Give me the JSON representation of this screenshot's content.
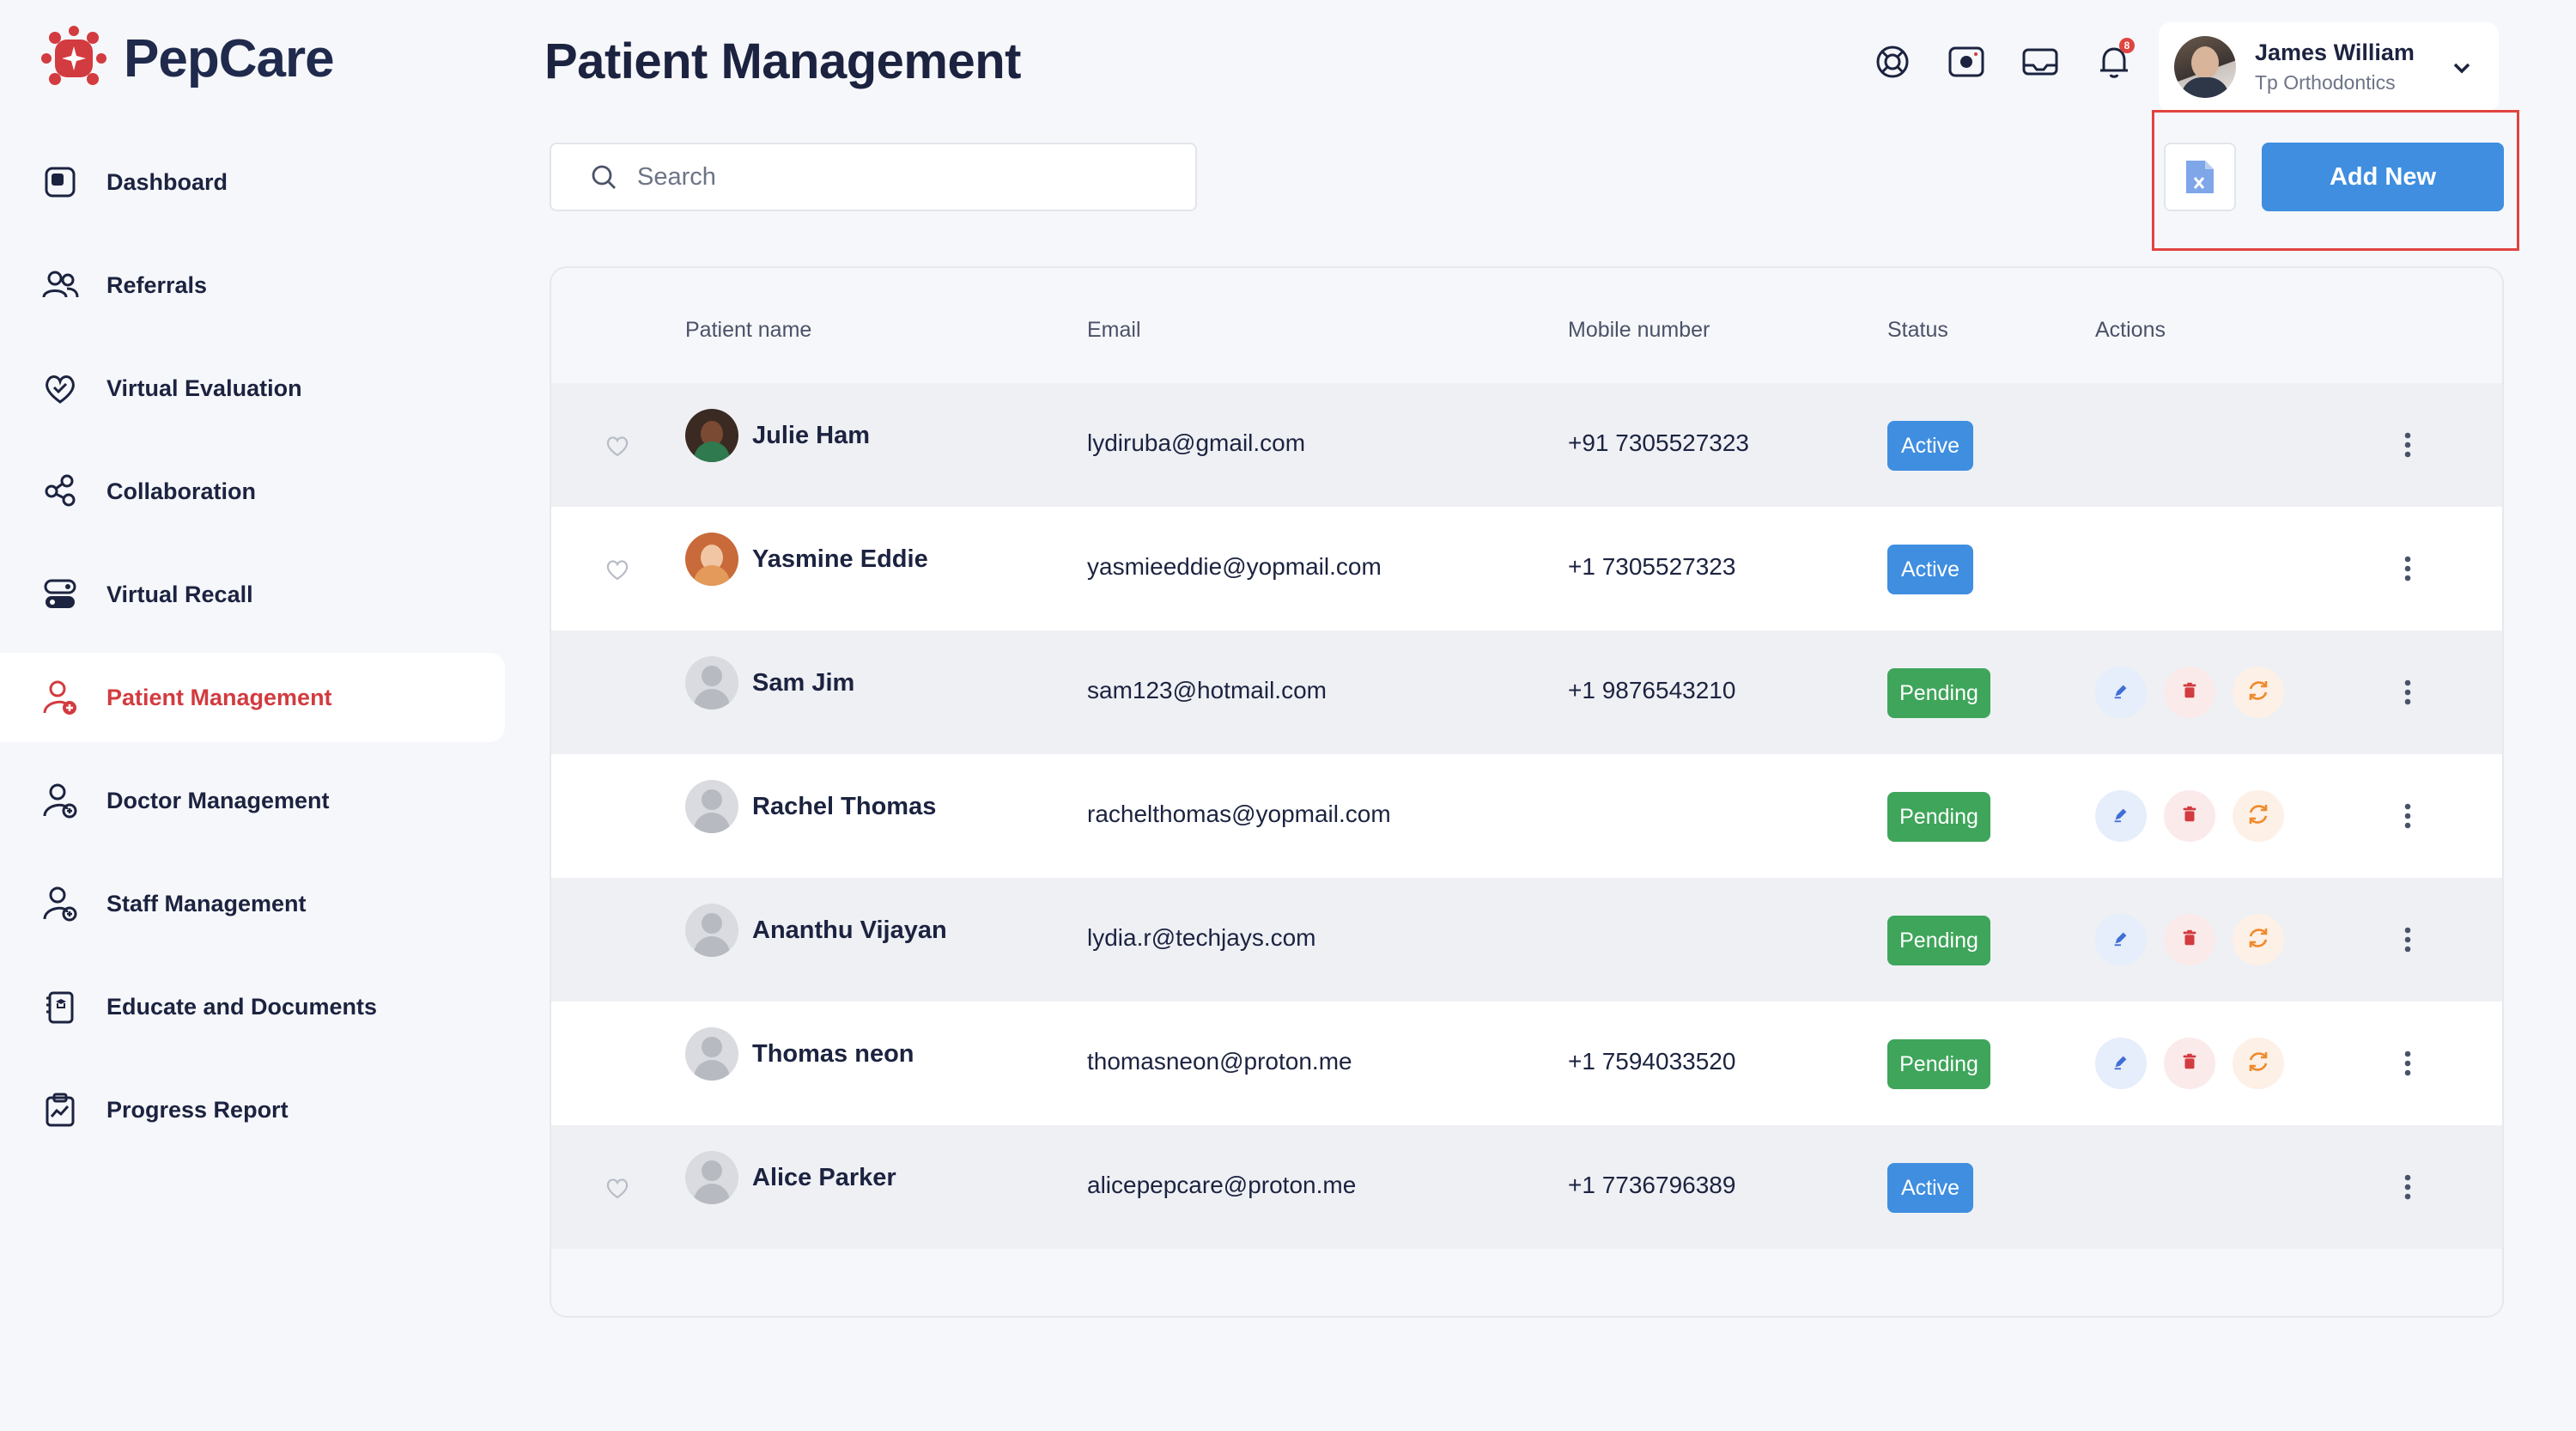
{
  "app": {
    "name": "PepCare"
  },
  "sidebar": {
    "items": [
      {
        "label": "Dashboard",
        "icon": "dashboard-icon"
      },
      {
        "label": "Referrals",
        "icon": "referrals-icon"
      },
      {
        "label": "Virtual Evaluation",
        "icon": "heart-check-icon"
      },
      {
        "label": "Collaboration",
        "icon": "collaboration-icon"
      },
      {
        "label": "Virtual Recall",
        "icon": "recall-icon"
      },
      {
        "label": "Patient Management",
        "icon": "patient-icon",
        "active": true
      },
      {
        "label": "Doctor Management",
        "icon": "doctor-icon"
      },
      {
        "label": "Staff Management",
        "icon": "staff-icon"
      },
      {
        "label": "Educate and Documents",
        "icon": "documents-icon"
      },
      {
        "label": "Progress Report",
        "icon": "progress-report-icon"
      }
    ]
  },
  "header": {
    "title": "Patient Management",
    "notification_count": "8",
    "icons": [
      "support-icon",
      "camera-icon",
      "mail-icon",
      "bell-icon"
    ]
  },
  "profile": {
    "name": "James William",
    "subtitle": "Tp Orthodontics"
  },
  "search": {
    "placeholder": "Search"
  },
  "toolbar": {
    "add_label": "Add New",
    "export_icon": "excel-file-icon"
  },
  "table": {
    "columns": [
      "Patient name",
      "Email",
      "Mobile number",
      "Status",
      "Actions"
    ],
    "rows": [
      {
        "name": "Julie Ham",
        "email": "lydiruba@gmail.com",
        "mobile": "+91 7305527323",
        "status": "Active",
        "avatar": "photo1",
        "favorite": true,
        "actions": false
      },
      {
        "name": "Yasmine Eddie",
        "email": "yasmieeddie@yopmail.com",
        "mobile": "+1 7305527323",
        "status": "Active",
        "avatar": "photo2",
        "favorite": true,
        "actions": false
      },
      {
        "name": "Sam Jim",
        "email": "sam123@hotmail.com",
        "mobile": "+1 9876543210",
        "status": "Pending",
        "avatar": "default",
        "favorite": false,
        "actions": true
      },
      {
        "name": "Rachel Thomas",
        "email": "rachelthomas@yopmail.com",
        "mobile": "",
        "status": "Pending",
        "avatar": "default",
        "favorite": false,
        "actions": true
      },
      {
        "name": "Ananthu Vijayan",
        "email": "lydia.r@techjays.com",
        "mobile": "",
        "status": "Pending",
        "avatar": "default",
        "favorite": false,
        "actions": true
      },
      {
        "name": "Thomas neon",
        "email": "thomasneon@proton.me",
        "mobile": "+1 7594033520",
        "status": "Pending",
        "avatar": "default",
        "favorite": false,
        "actions": true
      },
      {
        "name": "Alice Parker",
        "email": "alicepepcare@proton.me",
        "mobile": "+1 7736796389",
        "status": "Active",
        "avatar": "default",
        "favorite": true,
        "actions": false
      }
    ]
  },
  "colors": {
    "brand": "#d23b3f",
    "primary": "#3f8ee0",
    "active_badge": "#3f8ee0",
    "pending_badge": "#3ea55a",
    "highlight": "#e0443f"
  }
}
